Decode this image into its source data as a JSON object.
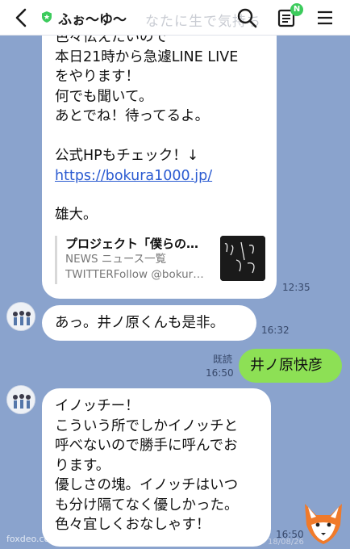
{
  "header": {
    "title": "ふぉ〜ゆ〜",
    "background_text": "なたに生で気持ち",
    "badge": "N",
    "icons": [
      "back-arrow-icon",
      "shield-status-icon",
      "search-icon",
      "notes-icon",
      "menu-icon"
    ]
  },
  "messages": [
    {
      "lines": "色々伝えたいので\n本日21時から急遽LINE LIVE\nをやります！\n何でも聞いて。\nあとでね！待ってるよ。\n\n公式HPもチェック！↓",
      "link": "https://bokura1000.jp/",
      "signature": "雄大。",
      "preview": {
        "title": "プロジェクト「僕らの…",
        "sub1": "NEWS ニュース一覧",
        "sub2": "TWITTERFollow @bokur…"
      },
      "time": "12:35"
    },
    {
      "text": "あっ。井ノ原くんも是非。",
      "time": "16:32"
    },
    {
      "text": "井ノ原快彦",
      "read": "既読",
      "time": "16:50"
    },
    {
      "lines": "イノッチー！\nこういう所でしかイノッチと\n呼べないので勝手に呼んでお\nります。\n優しさの塊。イノッチはいつ\nも分け隔てなく優しかった。\n色々宜しくおなしゃす！",
      "time": "16:50"
    }
  ],
  "watermark": "foxdeo.com/@ghostpreviews",
  "date_stamp": "18/08/26",
  "colors": {
    "chat_bg": "#8aa3cd",
    "my_bubble": "#8de055",
    "link": "#2b5bd1",
    "badge": "#3ccb5c"
  }
}
